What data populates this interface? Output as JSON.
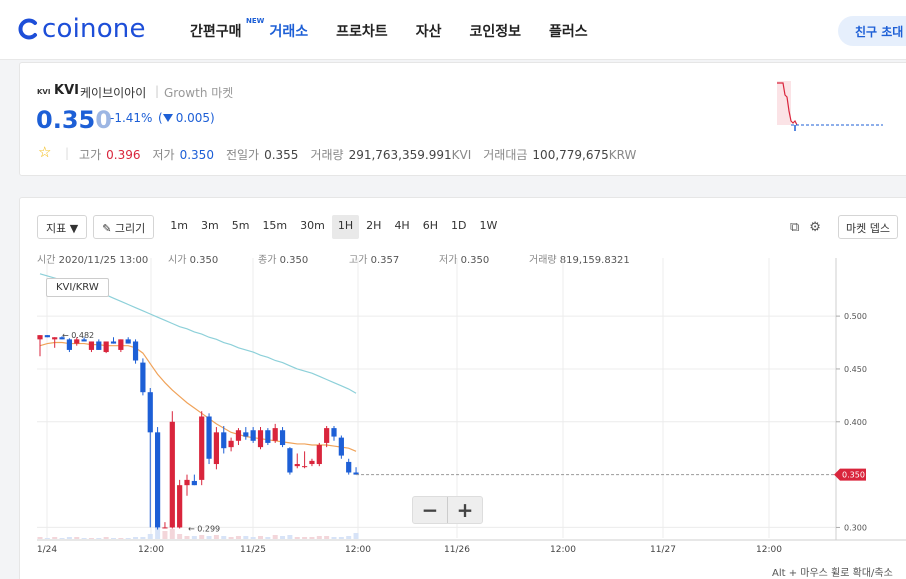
{
  "header": {
    "logo_text": "coinone",
    "nav": [
      {
        "label": "간편구매",
        "badge": "NEW",
        "active": false
      },
      {
        "label": "거래소",
        "active": true
      },
      {
        "label": "프로차트",
        "active": false
      },
      {
        "label": "자산",
        "active": false
      },
      {
        "label": "코인정보",
        "active": false
      },
      {
        "label": "플러스",
        "active": false
      }
    ],
    "invite_button": "친구 초대 이"
  },
  "ticker": {
    "icon_text": "KVI",
    "symbol": "KVI",
    "name": "케이브이아이",
    "separator": "|",
    "market": "Growth 마켓",
    "price_main": "0.35",
    "price_last": "0",
    "change_rate": "-1.41%",
    "change_amount": "0.005",
    "stats": {
      "high_label": "고가",
      "high": "0.396",
      "low_label": "저가",
      "low": "0.350",
      "prev_label": "전일가",
      "prev": "0.355",
      "volume_label": "거래량",
      "volume": "291,763,359.991",
      "volume_unit": "KVI",
      "amount_label": "거래대금",
      "amount": "100,779,675",
      "amount_unit": "KRW"
    },
    "colors": {
      "up": "#d9253c",
      "down": "#1d5fd6",
      "star": "#f2b705"
    }
  },
  "chart_toolbar": {
    "indicator_label": "지표 ▼",
    "draw_label": "✎ 그리기",
    "timeframes": [
      "1m",
      "3m",
      "5m",
      "15m",
      "30m",
      "1H",
      "2H",
      "4H",
      "6H",
      "1D",
      "1W"
    ],
    "active_timeframe": "1H",
    "market_depth_label": "마켓 뎁스"
  },
  "ohlc": {
    "time_label": "시간",
    "time": "2020/11/25 13:00",
    "open_label": "시가",
    "open": "0.350",
    "close_label": "종가",
    "close": "0.350",
    "high_label": "고가",
    "high": "0.357",
    "low_label": "저가",
    "low": "0.350",
    "volume_label": "거래량",
    "volume": "819,159.8321"
  },
  "pair_label": "KVI/KRW",
  "zoom": {
    "minus": "−",
    "plus": "+"
  },
  "hint": "Alt + 마우스 휠로 확대/축소",
  "chart_data": {
    "type": "candlestick",
    "y_ticks": [
      "0.500",
      "0.450",
      "0.400",
      "0.300"
    ],
    "ylim": [
      0.29,
      0.555
    ],
    "x_ticks": [
      "1/24",
      "12:00",
      "11/25",
      "12:00",
      "11/26",
      "12:00",
      "11/27",
      "12:00"
    ],
    "current_price_label": "0.350",
    "annotations": [
      {
        "label": "0.482"
      },
      {
        "label": "0.299"
      }
    ],
    "candles": [
      {
        "o": 0.478,
        "h": 0.482,
        "l": 0.462,
        "c": 0.482
      },
      {
        "o": 0.482,
        "h": 0.482,
        "l": 0.48,
        "c": 0.48
      },
      {
        "o": 0.478,
        "h": 0.48,
        "l": 0.47,
        "c": 0.48
      },
      {
        "o": 0.48,
        "h": 0.481,
        "l": 0.478,
        "c": 0.478
      },
      {
        "o": 0.478,
        "h": 0.479,
        "l": 0.466,
        "c": 0.468
      },
      {
        "o": 0.474,
        "h": 0.48,
        "l": 0.472,
        "c": 0.478
      },
      {
        "o": 0.478,
        "h": 0.48,
        "l": 0.476,
        "c": 0.476
      },
      {
        "o": 0.468,
        "h": 0.476,
        "l": 0.466,
        "c": 0.476
      },
      {
        "o": 0.476,
        "h": 0.478,
        "l": 0.468,
        "c": 0.468
      },
      {
        "o": 0.466,
        "h": 0.476,
        "l": 0.465,
        "c": 0.476
      },
      {
        "o": 0.476,
        "h": 0.48,
        "l": 0.474,
        "c": 0.474
      },
      {
        "o": 0.468,
        "h": 0.478,
        "l": 0.466,
        "c": 0.478
      },
      {
        "o": 0.478,
        "h": 0.48,
        "l": 0.474,
        "c": 0.474
      },
      {
        "o": 0.476,
        "h": 0.478,
        "l": 0.455,
        "c": 0.458
      },
      {
        "o": 0.456,
        "h": 0.46,
        "l": 0.425,
        "c": 0.428
      },
      {
        "o": 0.428,
        "h": 0.432,
        "l": 0.3,
        "c": 0.39
      },
      {
        "o": 0.39,
        "h": 0.395,
        "l": 0.298,
        "c": 0.3
      },
      {
        "o": 0.3,
        "h": 0.305,
        "l": 0.299,
        "c": 0.3
      },
      {
        "o": 0.3,
        "h": 0.41,
        "l": 0.299,
        "c": 0.4
      },
      {
        "o": 0.3,
        "h": 0.345,
        "l": 0.299,
        "c": 0.34
      },
      {
        "o": 0.34,
        "h": 0.35,
        "l": 0.33,
        "c": 0.345
      },
      {
        "o": 0.344,
        "h": 0.35,
        "l": 0.34,
        "c": 0.34
      },
      {
        "o": 0.345,
        "h": 0.41,
        "l": 0.34,
        "c": 0.405
      },
      {
        "o": 0.405,
        "h": 0.408,
        "l": 0.36,
        "c": 0.365
      },
      {
        "o": 0.36,
        "h": 0.395,
        "l": 0.355,
        "c": 0.39
      },
      {
        "o": 0.39,
        "h": 0.396,
        "l": 0.37,
        "c": 0.375
      },
      {
        "o": 0.376,
        "h": 0.385,
        "l": 0.372,
        "c": 0.382
      },
      {
        "o": 0.382,
        "h": 0.394,
        "l": 0.378,
        "c": 0.392
      },
      {
        "o": 0.39,
        "h": 0.395,
        "l": 0.383,
        "c": 0.386
      },
      {
        "o": 0.392,
        "h": 0.395,
        "l": 0.38,
        "c": 0.382
      },
      {
        "o": 0.376,
        "h": 0.395,
        "l": 0.374,
        "c": 0.392
      },
      {
        "o": 0.392,
        "h": 0.394,
        "l": 0.378,
        "c": 0.38
      },
      {
        "o": 0.382,
        "h": 0.398,
        "l": 0.38,
        "c": 0.394
      },
      {
        "o": 0.392,
        "h": 0.395,
        "l": 0.376,
        "c": 0.378
      },
      {
        "o": 0.375,
        "h": 0.376,
        "l": 0.35,
        "c": 0.352
      },
      {
        "o": 0.358,
        "h": 0.37,
        "l": 0.356,
        "c": 0.36
      },
      {
        "o": 0.358,
        "h": 0.372,
        "l": 0.356,
        "c": 0.358
      },
      {
        "o": 0.36,
        "h": 0.365,
        "l": 0.358,
        "c": 0.363
      },
      {
        "o": 0.36,
        "h": 0.38,
        "l": 0.358,
        "c": 0.378
      },
      {
        "o": 0.38,
        "h": 0.396,
        "l": 0.376,
        "c": 0.394
      },
      {
        "o": 0.394,
        "h": 0.396,
        "l": 0.382,
        "c": 0.386
      },
      {
        "o": 0.385,
        "h": 0.387,
        "l": 0.365,
        "c": 0.368
      },
      {
        "o": 0.362,
        "h": 0.365,
        "l": 0.35,
        "c": 0.352
      },
      {
        "o": 0.352,
        "h": 0.357,
        "l": 0.35,
        "c": 0.35
      }
    ],
    "ma_short": [
      0.472,
      0.474,
      0.475,
      0.475,
      0.474,
      0.474,
      0.474,
      0.473,
      0.473,
      0.472,
      0.472,
      0.472,
      0.472,
      0.47,
      0.465,
      0.455,
      0.445,
      0.437,
      0.43,
      0.424,
      0.418,
      0.413,
      0.408,
      0.403,
      0.398,
      0.394,
      0.39,
      0.388,
      0.386,
      0.385,
      0.384,
      0.383,
      0.382,
      0.381,
      0.38,
      0.379,
      0.379,
      0.378,
      0.378,
      0.378,
      0.377,
      0.376,
      0.375,
      0.372
    ],
    "ma_long": [
      0.54,
      0.538,
      0.536,
      0.534,
      0.532,
      0.53,
      0.528,
      0.526,
      0.523,
      0.52,
      0.517,
      0.514,
      0.511,
      0.508,
      0.505,
      0.502,
      0.499,
      0.496,
      0.493,
      0.49,
      0.488,
      0.485,
      0.483,
      0.48,
      0.478,
      0.475,
      0.473,
      0.47,
      0.468,
      0.466,
      0.463,
      0.461,
      0.458,
      0.456,
      0.453,
      0.45,
      0.448,
      0.446,
      0.443,
      0.44,
      0.437,
      0.434,
      0.431,
      0.427
    ],
    "series_colors": {
      "up": "#d9253c",
      "down": "#1d5fd6",
      "ma_short": "#f0a35a",
      "ma_long": "#8dd0d9"
    }
  }
}
